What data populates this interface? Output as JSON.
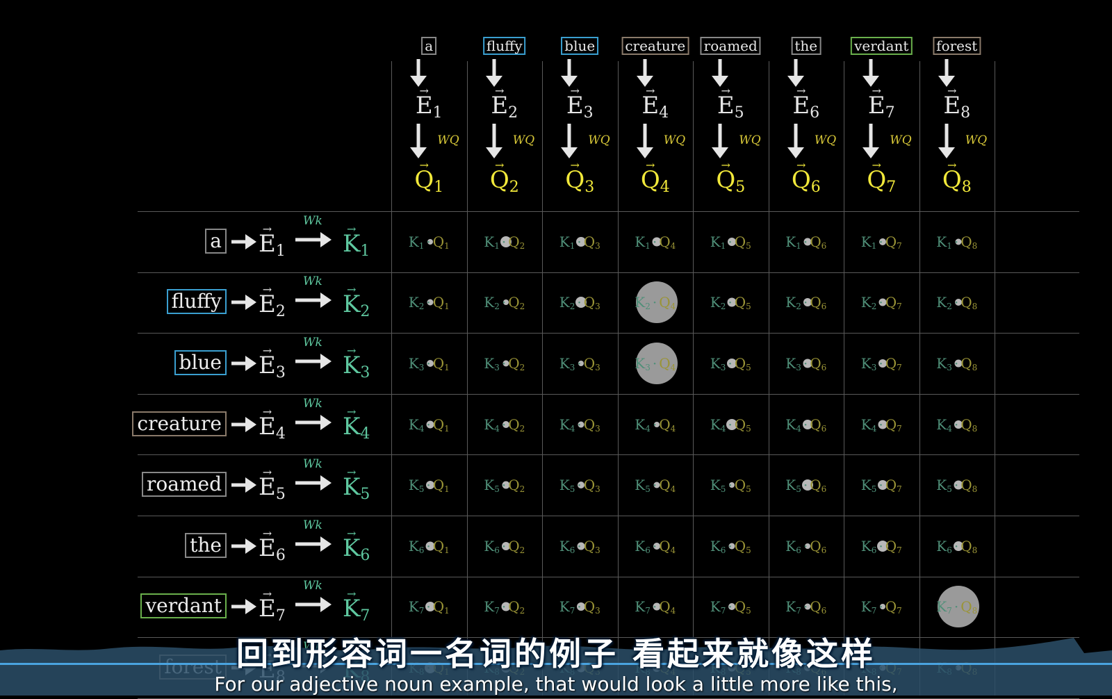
{
  "tokens": [
    {
      "word": "a",
      "color": "#888888"
    },
    {
      "word": "fluffy",
      "color": "#3a9fd0"
    },
    {
      "word": "blue",
      "color": "#3a9fd0"
    },
    {
      "word": "creature",
      "color": "#8a7a6a"
    },
    {
      "word": "roamed",
      "color": "#888888"
    },
    {
      "word": "the",
      "color": "#888888"
    },
    {
      "word": "verdant",
      "color": "#6ab04c"
    },
    {
      "word": "forest",
      "color": "#8a7a6a"
    }
  ],
  "symbols": {
    "embedding": "E",
    "query": "Q",
    "key": "K",
    "query_matrix": "WQ",
    "key_matrix": "Wk",
    "dot": "·"
  },
  "colors": {
    "key": "#5fc8a0",
    "query": "#f2e93a",
    "embedding": "#e6e6e6",
    "grid": "#5a5a5a",
    "bubble": "#b8b8b8"
  },
  "attention_highlights": [
    {
      "key": 2,
      "query": 4
    },
    {
      "key": 3,
      "query": 4
    },
    {
      "key": 7,
      "query": 8
    }
  ],
  "subtitles": {
    "chinese": "回到形容词一名词的例子  看起来就像这样",
    "english": "For our adjective noun example, that would look a little more like this,"
  }
}
